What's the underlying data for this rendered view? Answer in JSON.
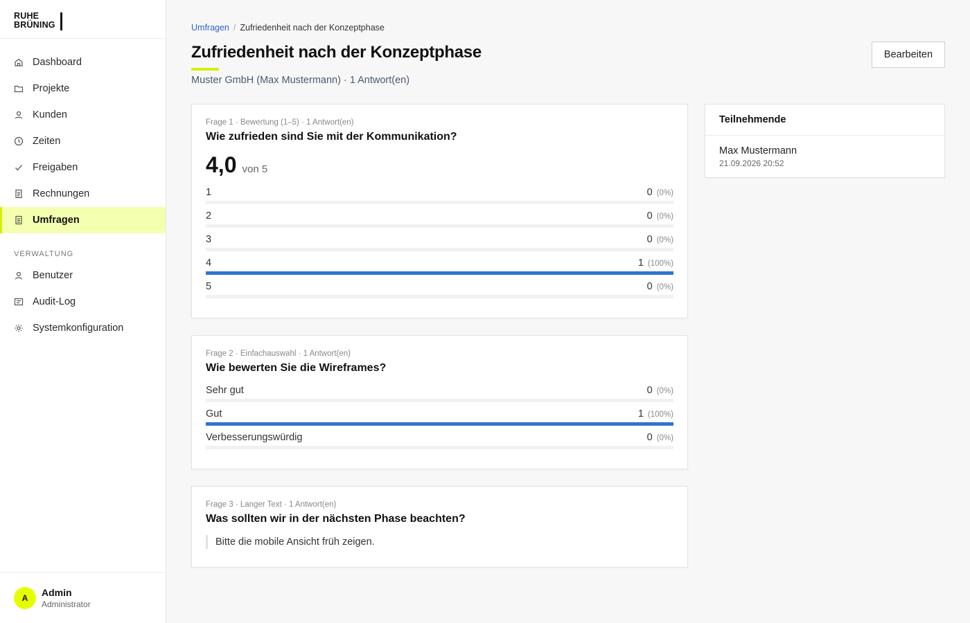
{
  "brand": {
    "line1": "RUHE",
    "line2": "BRÜNING"
  },
  "nav": {
    "items": [
      {
        "label": "Dashboard",
        "icon": "home-icon"
      },
      {
        "label": "Projekte",
        "icon": "folder-icon"
      },
      {
        "label": "Kunden",
        "icon": "user-icon"
      },
      {
        "label": "Zeiten",
        "icon": "clock-icon"
      },
      {
        "label": "Freigaben",
        "icon": "check-icon"
      },
      {
        "label": "Rechnungen",
        "icon": "document-icon"
      },
      {
        "label": "Umfragen",
        "icon": "survey-icon",
        "active": true
      }
    ],
    "section_label": "VERWALTUNG",
    "admin_items": [
      {
        "label": "Benutzer",
        "icon": "user-icon"
      },
      {
        "label": "Audit-Log",
        "icon": "list-icon"
      },
      {
        "label": "Systemkonfiguration",
        "icon": "gear-icon"
      }
    ]
  },
  "user": {
    "initial": "A",
    "name": "Admin",
    "role": "Administrator"
  },
  "breadcrumb": {
    "parent": "Umfragen",
    "separator": "/",
    "current": "Zufriedenheit nach der Konzeptphase"
  },
  "page": {
    "title": "Zufriedenheit nach der Konzeptphase",
    "subtitle": "Muster GmbH (Max Mustermann) · 1 Antwort(en)",
    "edit_label": "Bearbeiten"
  },
  "questions": [
    {
      "meta": "Frage 1 · Bewertung (1–5) · 1 Antwort(en)",
      "title": "Wie zufrieden sind Sie mit der Kommunikation?",
      "score": "4,0",
      "score_of": "von 5",
      "options": [
        {
          "label": "1",
          "count": "0",
          "pct": "(0%)",
          "fraction": 0
        },
        {
          "label": "2",
          "count": "0",
          "pct": "(0%)",
          "fraction": 0
        },
        {
          "label": "3",
          "count": "0",
          "pct": "(0%)",
          "fraction": 0
        },
        {
          "label": "4",
          "count": "1",
          "pct": "(100%)",
          "fraction": 1
        },
        {
          "label": "5",
          "count": "0",
          "pct": "(0%)",
          "fraction": 0
        }
      ]
    },
    {
      "meta": "Frage 2 · Einfachauswahl · 1 Antwort(en)",
      "title": "Wie bewerten Sie die Wireframes?",
      "options": [
        {
          "label": "Sehr gut",
          "count": "0",
          "pct": "(0%)",
          "fraction": 0
        },
        {
          "label": "Gut",
          "count": "1",
          "pct": "(100%)",
          "fraction": 1
        },
        {
          "label": "Verbesserungswürdig",
          "count": "0",
          "pct": "(0%)",
          "fraction": 0
        }
      ]
    },
    {
      "meta": "Frage 3 · Langer Text · 1 Antwort(en)",
      "title": "Was sollten wir in der nächsten Phase beachten?",
      "answer": "Bitte die mobile Ansicht früh zeigen."
    }
  ],
  "participants": {
    "heading": "Teilnehmende",
    "items": [
      {
        "name": "Max Mustermann",
        "date": "21.09.2026 20:52"
      }
    ]
  },
  "colors": {
    "accent": "#e6ff00",
    "active_bg": "#f4ffb0",
    "bar": "#2f74d0",
    "link": "#2d63c9"
  }
}
